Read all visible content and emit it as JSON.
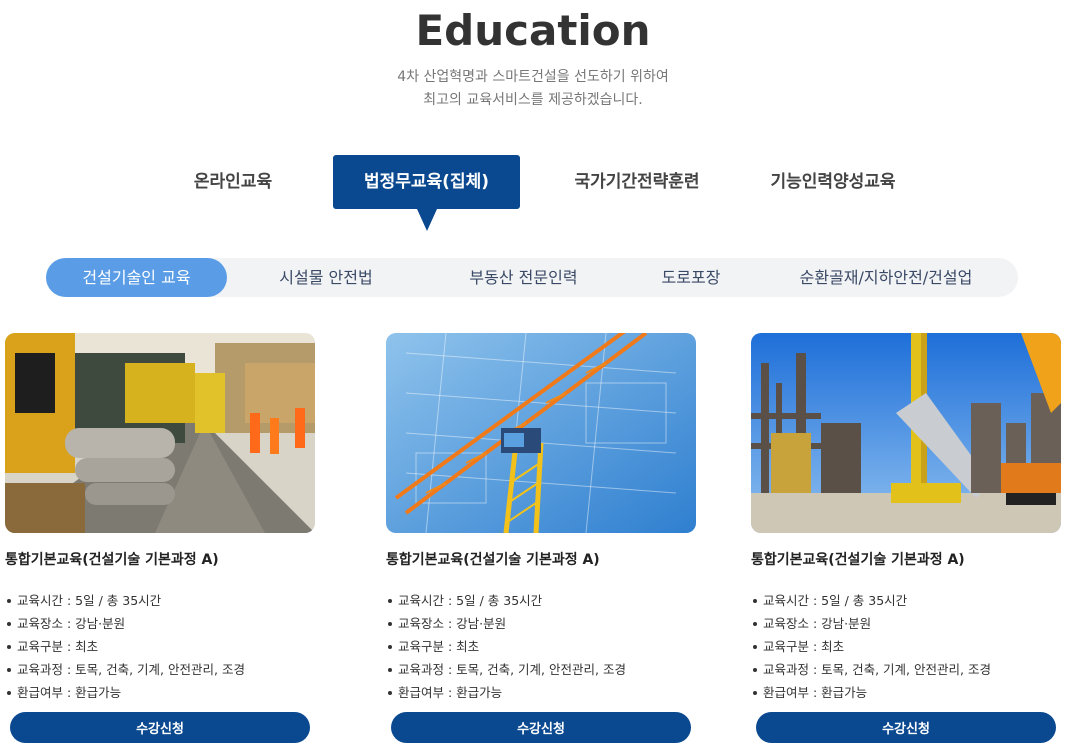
{
  "header": {
    "title": "Education",
    "subtitle_line1": "4차 산업혁명과 스마트건설을 선도하기 위하여",
    "subtitle_line2": "최고의 교육서비스를 제공하겠습니다."
  },
  "main_tabs": [
    {
      "label": "온라인교육",
      "active": false
    },
    {
      "label": "법정무교육(집체)",
      "active": true
    },
    {
      "label": "국가기간전략훈련",
      "active": false
    },
    {
      "label": "기능인력양성교육",
      "active": false
    }
  ],
  "sub_tabs": [
    {
      "label": "건설기술인 교육",
      "active": true
    },
    {
      "label": "시설물 안전법",
      "active": false
    },
    {
      "label": "부동산 전문인력",
      "active": false
    },
    {
      "label": "도로포장",
      "active": false
    },
    {
      "label": "순환골재/지하안전/건설업",
      "active": false
    }
  ],
  "cards": [
    {
      "image": "railway-construction-photo",
      "title": "통합기본교육(건설기술 기본과정 A)",
      "info": [
        "교육시간 : 5일 / 총 35시간",
        "교육장소 : 강남·분원",
        "교육구분 : 최초",
        "교육과정 : 토목, 건축, 기계, 안전관리, 조경",
        "환급여부 : 환급가능"
      ],
      "button": "수강신청"
    },
    {
      "image": "tower-crane-blueprint-photo",
      "title": "통합기본교육(건설기술 기본과정 A)",
      "info": [
        "교육시간 : 5일 / 총 35시간",
        "교육장소 : 강남·분원",
        "교육구분 : 최초",
        "교육과정 : 토목, 건축, 기계, 안전관리, 조경",
        "환급여부 : 환급가능"
      ],
      "button": "수강신청"
    },
    {
      "image": "industrial-plant-crane-photo",
      "title": "통합기본교육(건설기술 기본과정 A)",
      "info": [
        "교육시간 : 5일 / 총 35시간",
        "교육장소 : 강남·분원",
        "교육구분 : 최초",
        "교육과정 : 토목, 건축, 기계, 안전관리, 조경",
        "환급여부 : 환급가능"
      ],
      "button": "수강신청"
    }
  ],
  "colors": {
    "primary": "#0a4990",
    "subtab_active": "#5a9de6",
    "subtab_bg": "#f2f3f5"
  }
}
